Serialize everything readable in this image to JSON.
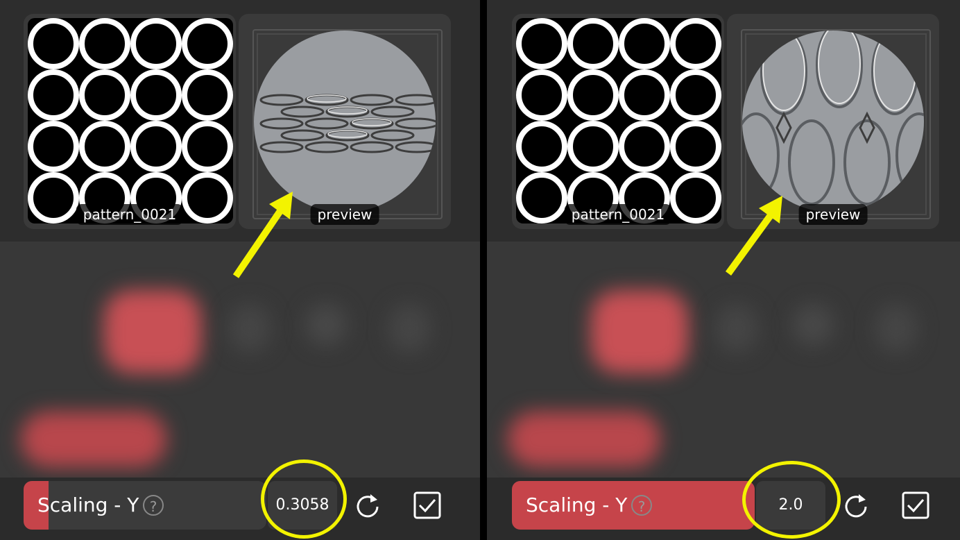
{
  "left": {
    "pattern_label": "pattern_0021",
    "preview_label": "preview",
    "slider": {
      "label": "Scaling - Y",
      "help": "?",
      "fill_fraction": 0.05
    },
    "value": "0.3058"
  },
  "right": {
    "pattern_label": "pattern_0021",
    "preview_label": "preview",
    "slider": {
      "label": "Scaling - Y",
      "help": "?",
      "fill_fraction": 1.0
    },
    "value": "2.0"
  },
  "colors": {
    "accent": "#c6444a",
    "highlight": "#f3f300",
    "panel_bg": "#2d2d2d"
  },
  "icons": [
    "question-icon",
    "reset-icon",
    "checkbox-icon",
    "arrow-icon"
  ]
}
